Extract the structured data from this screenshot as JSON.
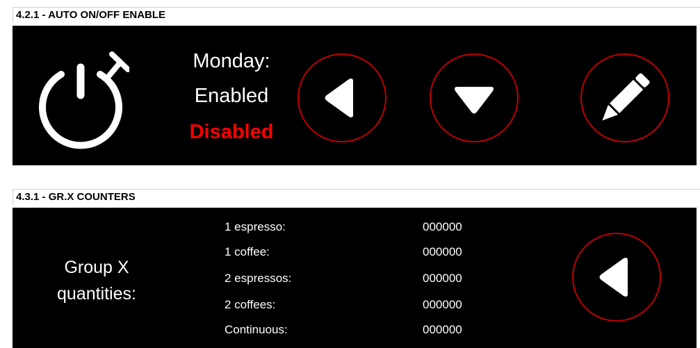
{
  "auto_onoff": {
    "title": "4.2.1 - AUTO ON/OFF ENABLE",
    "day_label": "Monday:",
    "option_enabled": "Enabled",
    "option_disabled": "Disabled",
    "icon": "power-timer-icon",
    "buttons": [
      "back-button",
      "down-button",
      "edit-button"
    ]
  },
  "counters": {
    "title": "4.3.1 - GR.X COUNTERS",
    "group_label_line1": "Group X",
    "group_label_line2": "quantities:",
    "rows": [
      {
        "label": "1 espresso:",
        "value": "000000"
      },
      {
        "label": "1 coffee:",
        "value": "000000"
      },
      {
        "label": "2 espressos:",
        "value": "000000"
      },
      {
        "label": "2 coffees:",
        "value": "000000"
      },
      {
        "label": "Continuous:",
        "value": "000000"
      }
    ]
  },
  "colors": {
    "accent_red": "#c00000",
    "disabled_red": "#ff0000",
    "panel_bg": "#000000"
  }
}
